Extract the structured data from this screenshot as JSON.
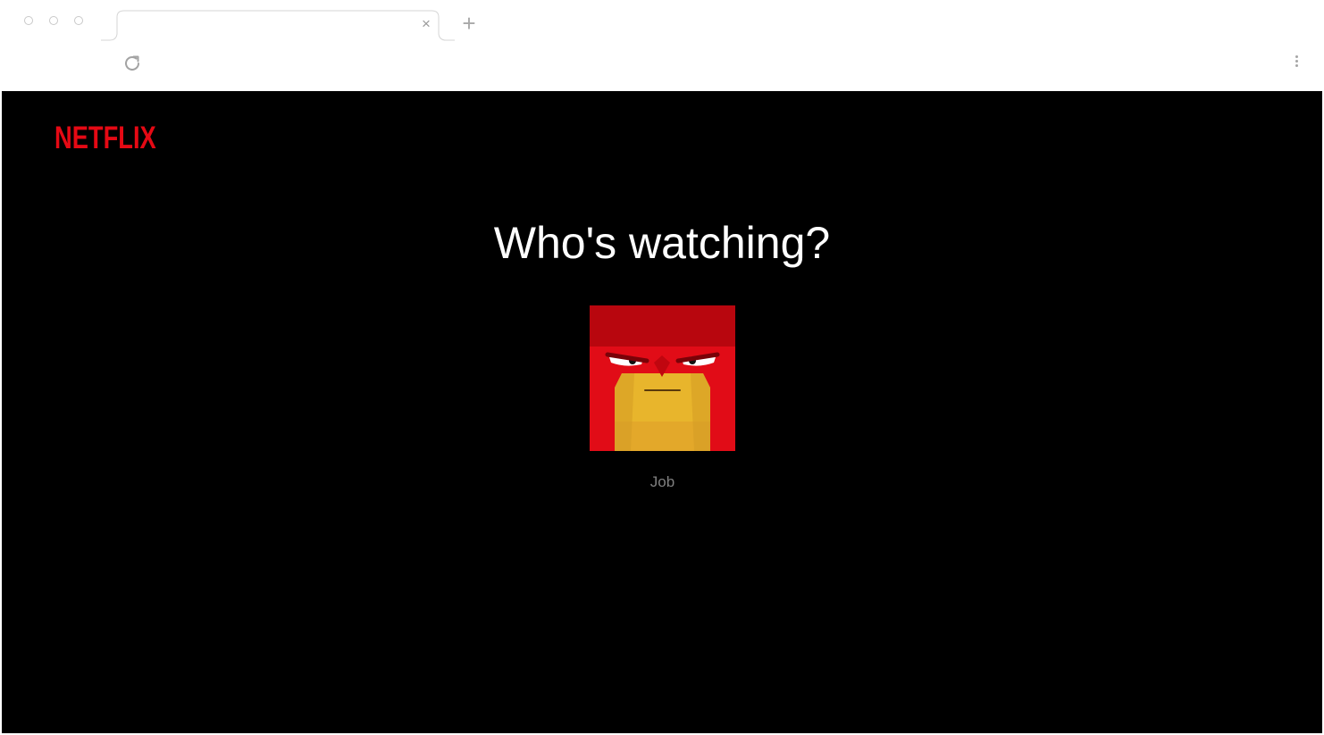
{
  "browser": {
    "tab_close_glyph": "×",
    "new_tab_glyph": "+",
    "icons": [
      "reload-icon",
      "kebab-menu-icon",
      "close-icon",
      "plus-icon"
    ]
  },
  "page": {
    "logo_text": "NETFLIX",
    "heading": "Who's watching?",
    "profiles": [
      {
        "name": "Job",
        "avatar_icon": "red-angry-face-avatar"
      }
    ]
  },
  "colors": {
    "brand_red": "#e50914",
    "background": "#000000",
    "heading_text": "#ffffff",
    "profile_name_text": "#808080",
    "avatar_red": "#e10c17",
    "avatar_yellow": "#e8b52c"
  }
}
